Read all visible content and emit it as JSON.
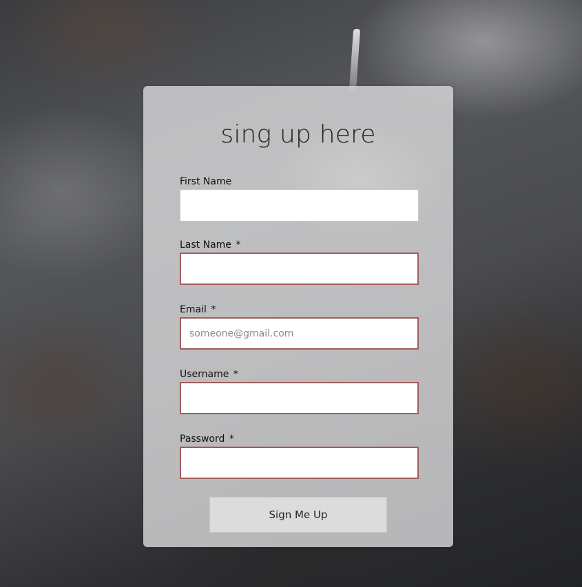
{
  "form": {
    "title": "sing up here",
    "fields": [
      {
        "label": "First Name",
        "required": "",
        "placeholder": "",
        "value": ""
      },
      {
        "label": "Last Name",
        "required": "*",
        "placeholder": "",
        "value": ""
      },
      {
        "label": "Email",
        "required": "*",
        "placeholder": "someone@gmail.com",
        "value": ""
      },
      {
        "label": "Username",
        "required": "*",
        "placeholder": "",
        "value": ""
      },
      {
        "label": "Password",
        "required": "*",
        "placeholder": "",
        "value": ""
      }
    ],
    "submit_label": "Sign Me Up"
  },
  "colors": {
    "invalid_border": "#a35b5b",
    "card_background": "#d7d7d8",
    "button_background": "#dcdcdc"
  }
}
